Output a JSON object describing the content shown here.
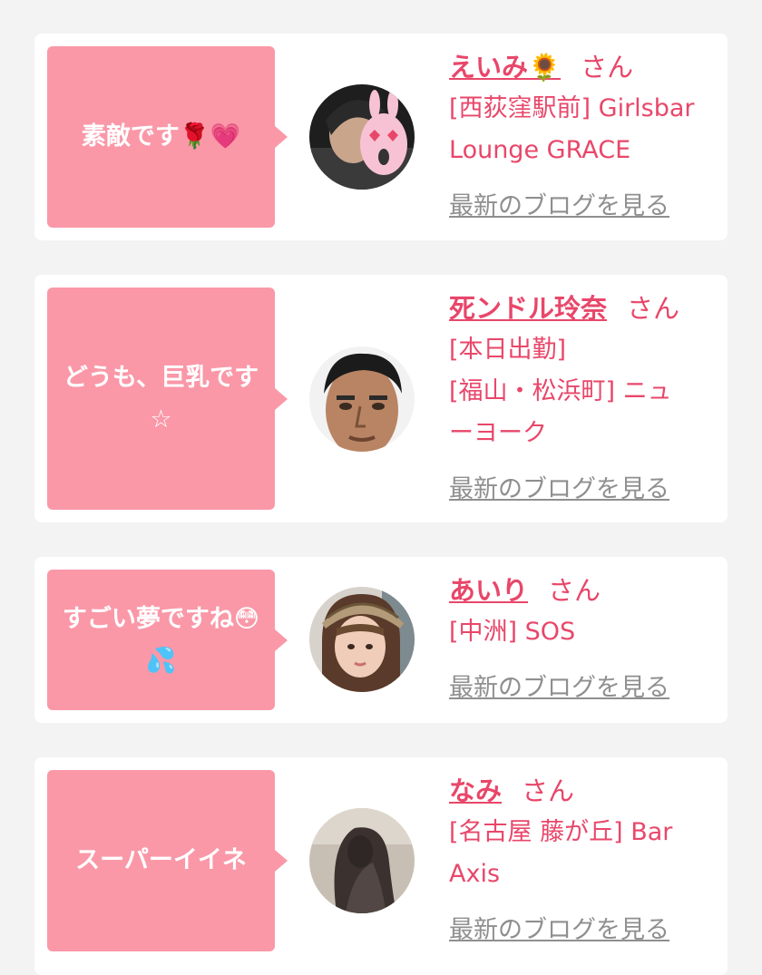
{
  "colors": {
    "bubble": "#fa98a8",
    "name": "#e8476a",
    "blog_link": "#8f8f8f",
    "card": "#ffffff",
    "background": "#f3f3f3"
  },
  "blog_link_label": "最新のブログを見る",
  "honorific": "さん",
  "items": [
    {
      "comment": "素敵です🌹💗",
      "name": "えいみ🌻",
      "shop_lines": [
        "[西荻窪駅前] Girlsbar",
        "Lounge GRACE"
      ],
      "avatar": "avatar-photo-sticker"
    },
    {
      "comment": "どうも、巨乳です☆",
      "name": "死ンドル玲奈",
      "shop_lines": [
        "[本日出勤]",
        "[福山・松浜町] ニュ",
        "ーヨーク"
      ],
      "avatar": "avatar-photo-face"
    },
    {
      "comment": "すごい夢ですね😳💦",
      "name": "あいり",
      "shop_lines": [
        "[中洲] SOS"
      ],
      "avatar": "avatar-photo-cap"
    },
    {
      "comment": "スーパーイイネ",
      "name": "なみ",
      "shop_lines": [
        "[名古屋 藤が丘] Bar",
        "Axis"
      ],
      "avatar": "avatar-photo-hair"
    }
  ]
}
